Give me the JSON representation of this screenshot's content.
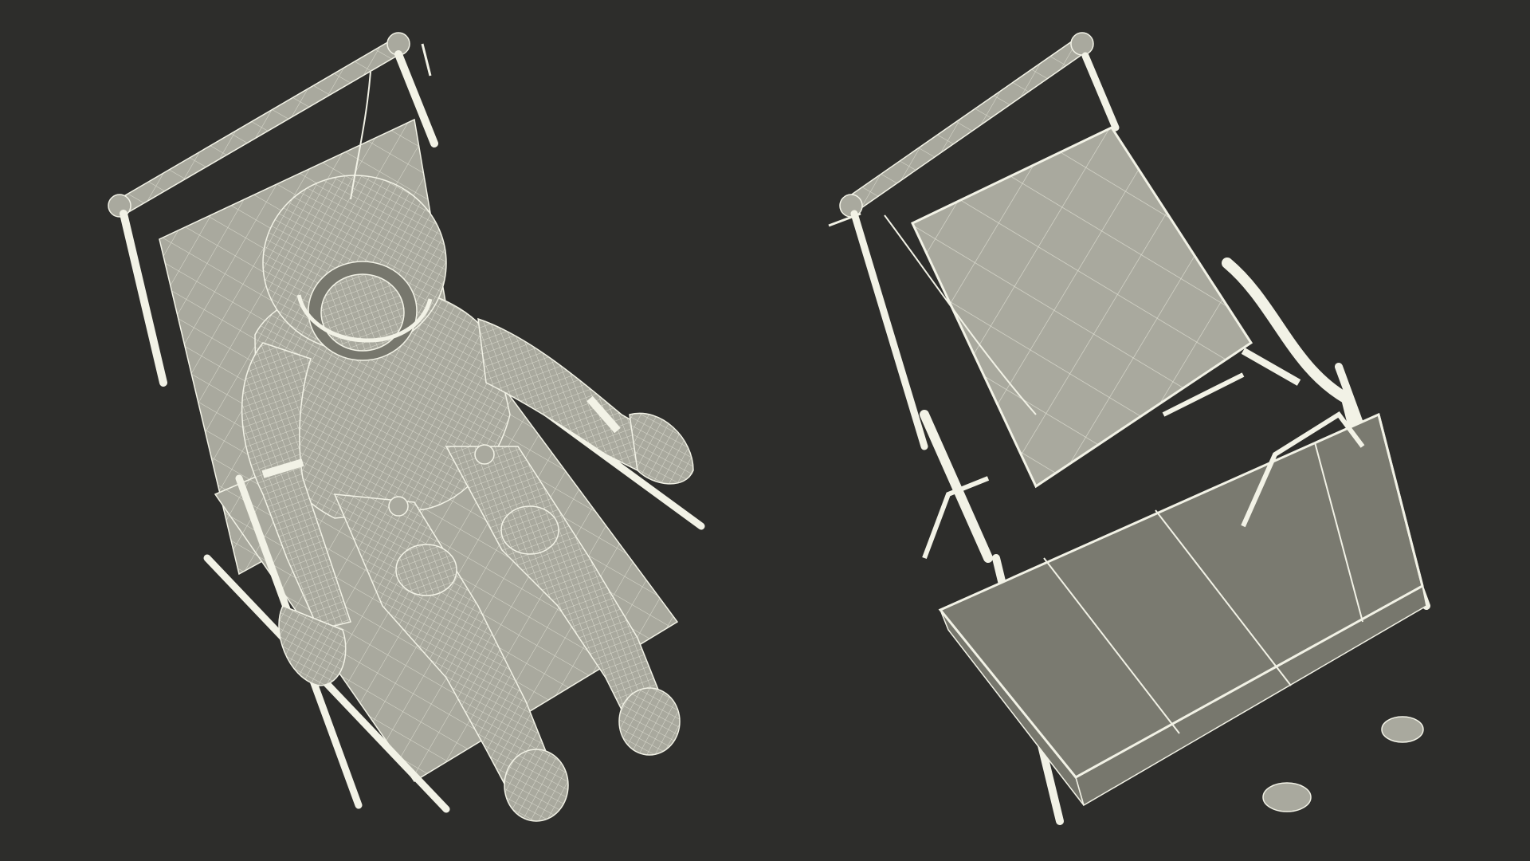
{
  "scene": {
    "background_color": "#2d2d2b",
    "model_fill_color": "#a9a99e",
    "model_shadow_color": "#77776d",
    "wire_color": "#f2f2e6",
    "panel_fill_color": "#7a7a70"
  },
  "views": [
    {
      "subject": "astronaut-in-ejection-seat-wireframe-front-view"
    },
    {
      "subject": "ejection-seat-wireframe-rear-view"
    }
  ]
}
